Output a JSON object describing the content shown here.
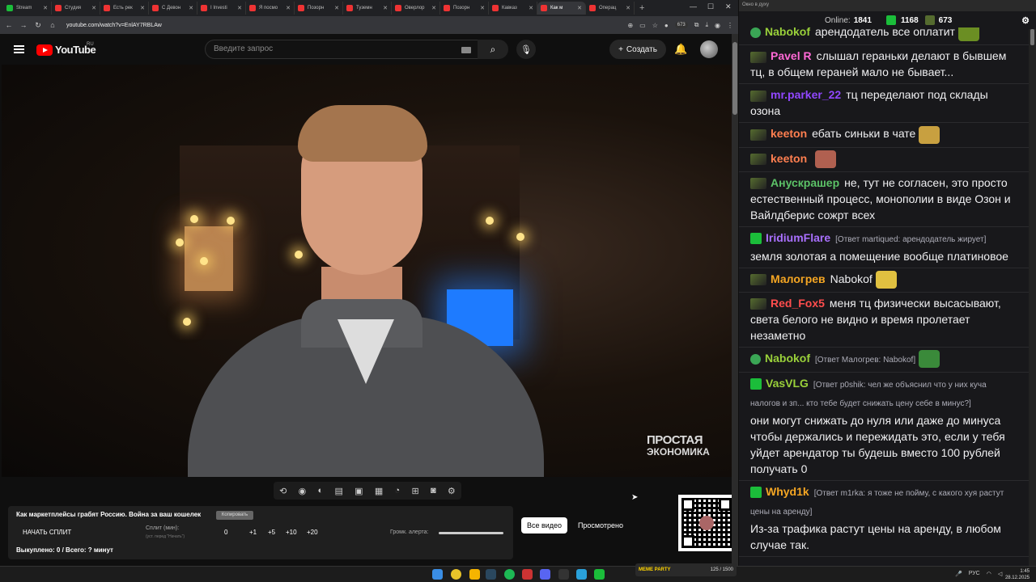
{
  "browser": {
    "tabs": [
      {
        "label": "Stream",
        "color": "#1bbd3a"
      },
      {
        "label": "Студия",
        "color": "#e33"
      },
      {
        "label": "Есть рек",
        "color": "#e33"
      },
      {
        "label": "С Девон",
        "color": "#e33"
      },
      {
        "label": "I Investi",
        "color": "#e33"
      },
      {
        "label": "Я посмо",
        "color": "#e33"
      },
      {
        "label": "Позорн",
        "color": "#e33"
      },
      {
        "label": "Туземн",
        "color": "#e33"
      },
      {
        "label": "Оверлор",
        "color": "#e33"
      },
      {
        "label": "Позорн",
        "color": "#e33"
      },
      {
        "label": "Кавказ",
        "color": "#e33"
      },
      {
        "label": "Как м",
        "color": "#e33",
        "active": true
      },
      {
        "label": "Операц",
        "color": "#e33"
      }
    ],
    "url": "youtube.com/watch?v=EnlAY7RBLAw",
    "badge_count": "673"
  },
  "youtube": {
    "logo_text": "YouTube",
    "region": "RU",
    "search_placeholder": "Введите запрос",
    "create_label": "Создать"
  },
  "video": {
    "watermark_line1": "ПРОСТАЯ",
    "watermark_line2": "ЭКОНОМИКА"
  },
  "panel": {
    "title": "Как маркетплейсы грабят Россию. Война за ваш кошелек",
    "copy_label": "Копировать",
    "start_split": "НАЧАТЬ СПЛИТ",
    "split_label": "Сплит (мин):",
    "split_hint": "(уст. перед \"Начать\")",
    "split_value": "0",
    "inc1": "+1",
    "inc5": "+5",
    "inc10": "+10",
    "inc20": "+20",
    "alert_label": "Громк. алерта:",
    "alert_volume": 1.0,
    "bought": "Выкуплено: 0 / Всего: ? минут",
    "all_videos": "Все видео",
    "watched": "Просмотрено"
  },
  "chat": {
    "window_title": "Окно в духу",
    "online_label": "Online:",
    "online_count": "1841",
    "kick_count": "1168",
    "other_count": "673",
    "messages": [
      {
        "user": "Nabokof",
        "color": "#9ad13a",
        "text": "арендодатель все оплатит",
        "badge": "ok"
      },
      {
        "user": "Pavel R",
        "color": "#ff69d6",
        "text": "слышал гераньки делают в бывшем тц, в общем гераней мало не бывает...",
        "badge": "b"
      },
      {
        "user": "mr.parker_22",
        "color": "#9147ff",
        "text": "тц переделают под склады озона",
        "badge": "b"
      },
      {
        "user": "keeton",
        "color": "#ff7f50",
        "text": "ебать синьки в чате",
        "badge": "b"
      },
      {
        "user": "keeton",
        "color": "#ff7f50",
        "text": "",
        "badge": "b"
      },
      {
        "user": "Анускрашер",
        "color": "#5cc267",
        "text": "не, тут не согласен, это просто естественный процесс, монополии в виде Озон и Вайлдберис сожрт всех",
        "badge": "b"
      },
      {
        "user": "IridiumFlare",
        "color": "#a970ff",
        "reply": "[Ответ martiqued: арендодатель жирует]",
        "text": "земля золотая а помещение вообще платиновое",
        "badge": "k"
      },
      {
        "user": "Малогрев",
        "color": "#f5a623",
        "text": "Nabokof",
        "badge": "b"
      },
      {
        "user": "Red_Fox5",
        "color": "#ff4d4d",
        "text": "меня тц физически высасывают, света белого не видно и время пролетает незаметно",
        "badge": "b"
      },
      {
        "user": "Nabokof",
        "color": "#9ad13a",
        "reply": "[Ответ Малогрев: Nabokof]",
        "text": "",
        "badge": "ok"
      },
      {
        "user": "VasVLG",
        "color": "#9ad13a",
        "reply": "[Ответ p0shik: чел же объяснил что у них куча налогов и зп... кто тебе будет снижать цену себе в минус?]",
        "text": "они могут снижать до нуля или даже до минуса чтобы держались и пережидать это, если у тебя уйдет арендатор ты будешь вместо 100 рублей получать 0",
        "badge": "k"
      },
      {
        "user": "Whyd1k",
        "color": "#f5a623",
        "reply": "[Ответ m1rka: я тоже не пойму, с какого хуя растут цены на аренду]",
        "text": "Из-за трафика растут цены на аренду, в любом случае так.",
        "badge": "k"
      }
    ]
  },
  "taskbar": {
    "meme_label": "MEME PARTY",
    "meme_progress": "125 / 1500",
    "lang": "РУС",
    "time": "1:45",
    "date": "28.12.2025"
  }
}
